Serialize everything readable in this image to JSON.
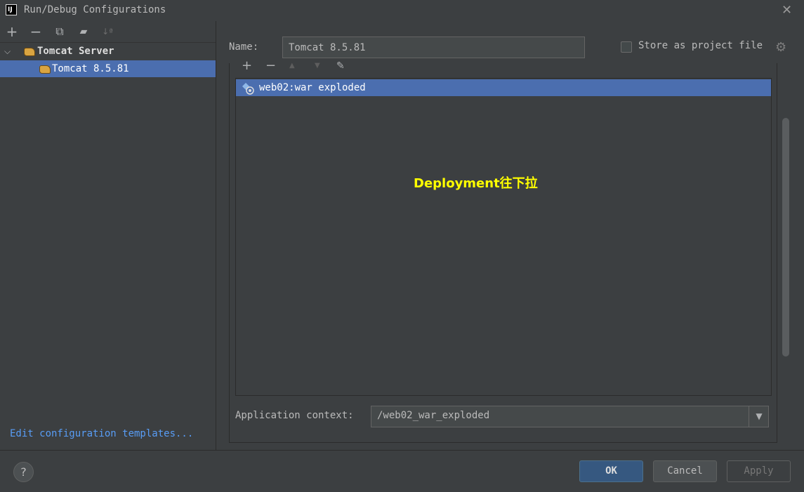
{
  "window": {
    "title": "Run/Debug Configurations",
    "app_icon_text": "IJ"
  },
  "toolbar": {
    "add": "+",
    "remove": "−",
    "copy": "⧉",
    "folder": "▰",
    "sort": "↓ª"
  },
  "tree": {
    "group_label": "Tomcat Server",
    "item_label": "Tomcat 8.5.81"
  },
  "edit_templates_link": "Edit configuration templates...",
  "form": {
    "name_label": "Name:",
    "name_value": "Tomcat 8.5.81",
    "store_label": "Store as project file",
    "store_checked": false
  },
  "deployment": {
    "toolbar": {
      "add": "+",
      "remove": "−",
      "up": "▲",
      "down": "▼",
      "edit": "✎"
    },
    "items": [
      "web02:war exploded"
    ],
    "annotation": "Deployment往下拉",
    "app_context_label": "Application context:",
    "app_context_value": "/web02_war_exploded"
  },
  "buttons": {
    "help": "?",
    "ok": "OK",
    "cancel": "Cancel",
    "apply": "Apply"
  },
  "colors": {
    "selection": "#4b6eaf",
    "link": "#589df6",
    "annotation": "#ffff00",
    "primary_button": "#365880"
  }
}
